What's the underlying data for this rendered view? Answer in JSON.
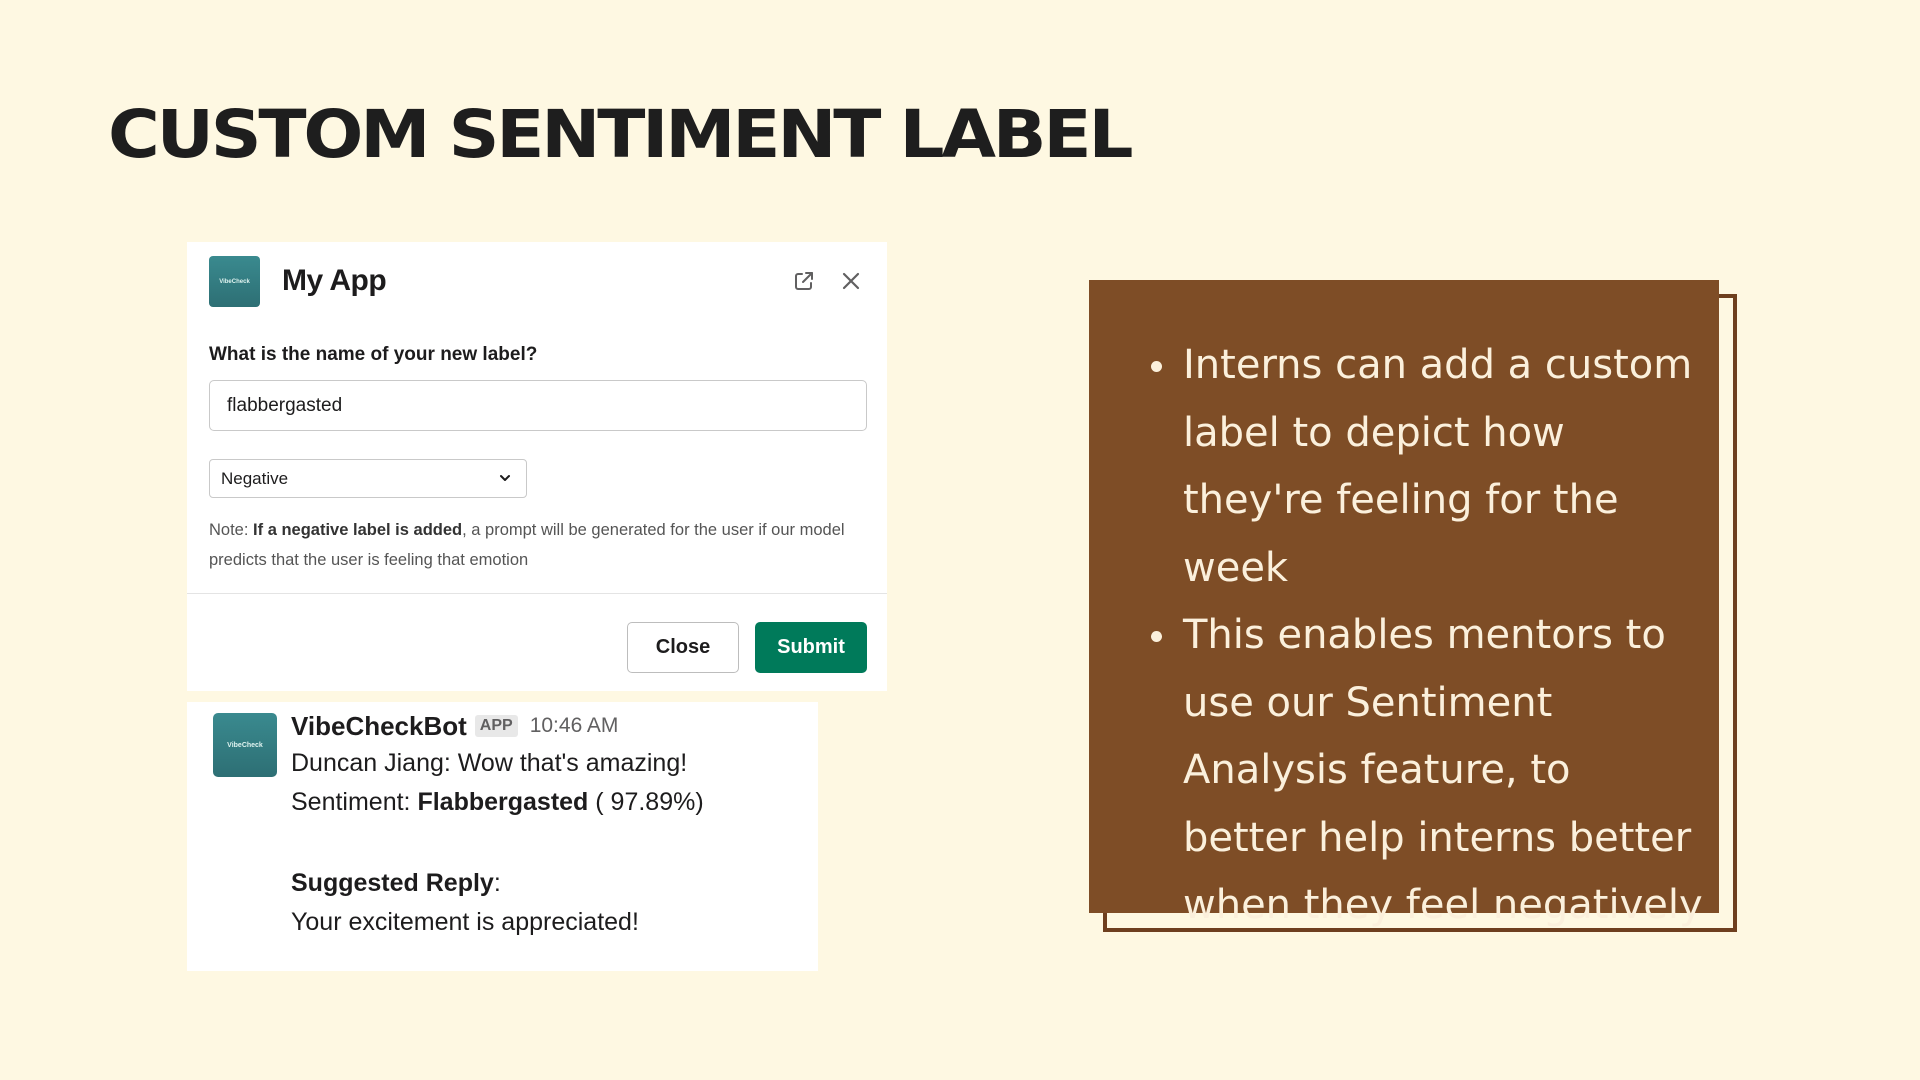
{
  "slide": {
    "title": "CUSTOM SENTIMENT LABEL"
  },
  "modal": {
    "app_logo_text": "VibeCheck",
    "title": "My App",
    "field_label": "What is the name of your new label?",
    "label_input_value": "flabbergasted",
    "sentiment_select_value": "Negative",
    "note_prefix": "Note: ",
    "note_bold": "If a negative label is added",
    "note_rest": ", a prompt will be generated for the user if our model predicts that the user is feeling that emotion",
    "close_label": "Close",
    "submit_label": "Submit",
    "icons": [
      "open-external-icon",
      "close-icon",
      "chevron-down-icon"
    ],
    "submit_color": "#007a5a"
  },
  "message": {
    "avatar_text": "VibeCheck",
    "sender": "VibeCheckBot",
    "badge": "APP",
    "time": "10:46 AM",
    "text": "Duncan Jiang: Wow that's amazing!",
    "sentiment_prefix": "Sentiment: ",
    "sentiment_label": "Flabbergasted",
    "sentiment_score": " ( 97.89%)",
    "suggested_label": "Suggested Reply",
    "suggested_colon": ":",
    "suggested_text": "Your excitement is appreciated!"
  },
  "info": {
    "bullets": [
      "Interns can add a custom label to depict how they're feeling for the week",
      "This enables mentors to use our Sentiment Analysis feature, to better help interns better when they feel negatively"
    ],
    "box_color": "#7E4D26",
    "background_color": "#FEF8E2"
  }
}
